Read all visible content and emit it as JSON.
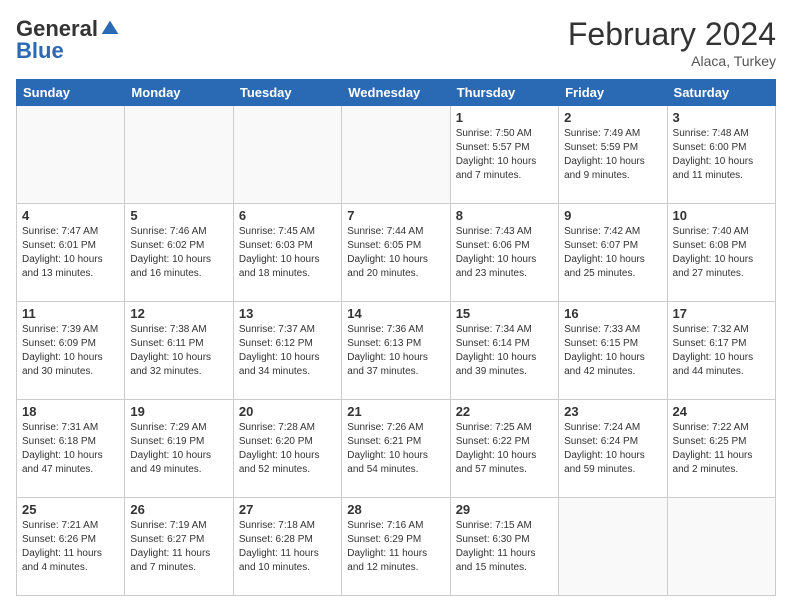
{
  "logo": {
    "general": "General",
    "blue": "Blue"
  },
  "title": {
    "month": "February 2024",
    "location": "Alaca, Turkey"
  },
  "days_of_week": [
    "Sunday",
    "Monday",
    "Tuesday",
    "Wednesday",
    "Thursday",
    "Friday",
    "Saturday"
  ],
  "weeks": [
    [
      {
        "num": "",
        "info": ""
      },
      {
        "num": "",
        "info": ""
      },
      {
        "num": "",
        "info": ""
      },
      {
        "num": "",
        "info": ""
      },
      {
        "num": "1",
        "info": "Sunrise: 7:50 AM\nSunset: 5:57 PM\nDaylight: 10 hours and 7 minutes."
      },
      {
        "num": "2",
        "info": "Sunrise: 7:49 AM\nSunset: 5:59 PM\nDaylight: 10 hours and 9 minutes."
      },
      {
        "num": "3",
        "info": "Sunrise: 7:48 AM\nSunset: 6:00 PM\nDaylight: 10 hours and 11 minutes."
      }
    ],
    [
      {
        "num": "4",
        "info": "Sunrise: 7:47 AM\nSunset: 6:01 PM\nDaylight: 10 hours and 13 minutes."
      },
      {
        "num": "5",
        "info": "Sunrise: 7:46 AM\nSunset: 6:02 PM\nDaylight: 10 hours and 16 minutes."
      },
      {
        "num": "6",
        "info": "Sunrise: 7:45 AM\nSunset: 6:03 PM\nDaylight: 10 hours and 18 minutes."
      },
      {
        "num": "7",
        "info": "Sunrise: 7:44 AM\nSunset: 6:05 PM\nDaylight: 10 hours and 20 minutes."
      },
      {
        "num": "8",
        "info": "Sunrise: 7:43 AM\nSunset: 6:06 PM\nDaylight: 10 hours and 23 minutes."
      },
      {
        "num": "9",
        "info": "Sunrise: 7:42 AM\nSunset: 6:07 PM\nDaylight: 10 hours and 25 minutes."
      },
      {
        "num": "10",
        "info": "Sunrise: 7:40 AM\nSunset: 6:08 PM\nDaylight: 10 hours and 27 minutes."
      }
    ],
    [
      {
        "num": "11",
        "info": "Sunrise: 7:39 AM\nSunset: 6:09 PM\nDaylight: 10 hours and 30 minutes."
      },
      {
        "num": "12",
        "info": "Sunrise: 7:38 AM\nSunset: 6:11 PM\nDaylight: 10 hours and 32 minutes."
      },
      {
        "num": "13",
        "info": "Sunrise: 7:37 AM\nSunset: 6:12 PM\nDaylight: 10 hours and 34 minutes."
      },
      {
        "num": "14",
        "info": "Sunrise: 7:36 AM\nSunset: 6:13 PM\nDaylight: 10 hours and 37 minutes."
      },
      {
        "num": "15",
        "info": "Sunrise: 7:34 AM\nSunset: 6:14 PM\nDaylight: 10 hours and 39 minutes."
      },
      {
        "num": "16",
        "info": "Sunrise: 7:33 AM\nSunset: 6:15 PM\nDaylight: 10 hours and 42 minutes."
      },
      {
        "num": "17",
        "info": "Sunrise: 7:32 AM\nSunset: 6:17 PM\nDaylight: 10 hours and 44 minutes."
      }
    ],
    [
      {
        "num": "18",
        "info": "Sunrise: 7:31 AM\nSunset: 6:18 PM\nDaylight: 10 hours and 47 minutes."
      },
      {
        "num": "19",
        "info": "Sunrise: 7:29 AM\nSunset: 6:19 PM\nDaylight: 10 hours and 49 minutes."
      },
      {
        "num": "20",
        "info": "Sunrise: 7:28 AM\nSunset: 6:20 PM\nDaylight: 10 hours and 52 minutes."
      },
      {
        "num": "21",
        "info": "Sunrise: 7:26 AM\nSunset: 6:21 PM\nDaylight: 10 hours and 54 minutes."
      },
      {
        "num": "22",
        "info": "Sunrise: 7:25 AM\nSunset: 6:22 PM\nDaylight: 10 hours and 57 minutes."
      },
      {
        "num": "23",
        "info": "Sunrise: 7:24 AM\nSunset: 6:24 PM\nDaylight: 10 hours and 59 minutes."
      },
      {
        "num": "24",
        "info": "Sunrise: 7:22 AM\nSunset: 6:25 PM\nDaylight: 11 hours and 2 minutes."
      }
    ],
    [
      {
        "num": "25",
        "info": "Sunrise: 7:21 AM\nSunset: 6:26 PM\nDaylight: 11 hours and 4 minutes."
      },
      {
        "num": "26",
        "info": "Sunrise: 7:19 AM\nSunset: 6:27 PM\nDaylight: 11 hours and 7 minutes."
      },
      {
        "num": "27",
        "info": "Sunrise: 7:18 AM\nSunset: 6:28 PM\nDaylight: 11 hours and 10 minutes."
      },
      {
        "num": "28",
        "info": "Sunrise: 7:16 AM\nSunset: 6:29 PM\nDaylight: 11 hours and 12 minutes."
      },
      {
        "num": "29",
        "info": "Sunrise: 7:15 AM\nSunset: 6:30 PM\nDaylight: 11 hours and 15 minutes."
      },
      {
        "num": "",
        "info": ""
      },
      {
        "num": "",
        "info": ""
      }
    ]
  ]
}
